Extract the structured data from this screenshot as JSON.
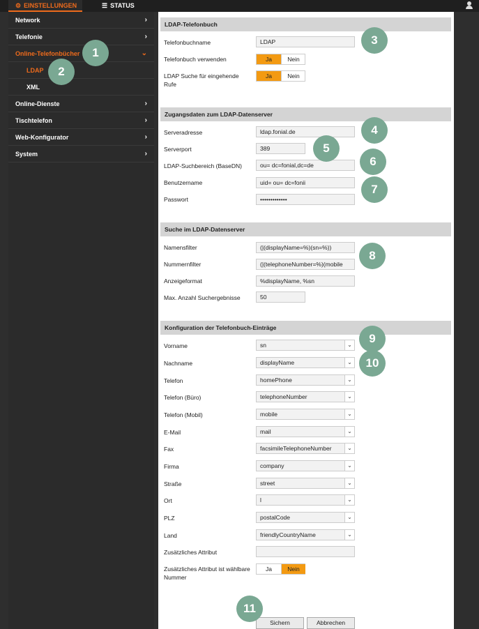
{
  "topbar": {
    "settings_tab": "EINSTELLUNGEN",
    "status_tab": "STATUS"
  },
  "sidebar": {
    "items": [
      {
        "label": "Network"
      },
      {
        "label": "Telefonie"
      },
      {
        "label": "Online-Telefonbücher"
      },
      {
        "label": "LDAP"
      },
      {
        "label": "XML"
      },
      {
        "label": "Online-Dienste"
      },
      {
        "label": "Tischtelefon"
      },
      {
        "label": "Web-Konfigurator"
      },
      {
        "label": "System"
      }
    ]
  },
  "ldap": {
    "header": "LDAP-Telefonbuch",
    "name_label": "Telefonbuchname",
    "name_value": "LDAP",
    "use_label": "Telefonbuch verwenden",
    "search_label": "LDAP Suche für eingehende Rufe",
    "yes": "Ja",
    "no": "Nein"
  },
  "server": {
    "header": "Zugangsdaten zum LDAP-Datenserver",
    "address_label": "Serveradresse",
    "address_value": "ldap.fonial.de",
    "port_label": "Serverport",
    "port_value": "389",
    "basedn_label": "LDAP-Suchbereich (BaseDN)",
    "basedn_value": "ou=         dc=fonial,dc=de",
    "user_label": "Benutzername",
    "user_value": "uid=       ou=       dc=fonii",
    "pass_label": "Passwort",
    "pass_value": "•••••••••••••"
  },
  "search": {
    "header": "Suche im LDAP-Datenserver",
    "namefilter_label": "Namensfilter",
    "namefilter_value": "(|(displayName=%)(sn=%))",
    "numberfilter_label": "Nummernfilter",
    "numberfilter_value": "(|(telephoneNumber=%)(mobile",
    "format_label": "Anzeigeformat",
    "format_value": "%displayName, %sn",
    "max_label": "Max. Anzahl Suchergebnisse",
    "max_value": "50"
  },
  "config": {
    "header": "Konfiguration der Telefonbuch-Einträge",
    "rows": [
      {
        "label": "Vorname",
        "value": "sn"
      },
      {
        "label": "Nachname",
        "value": "displayName"
      },
      {
        "label": "Telefon",
        "value": "homePhone"
      },
      {
        "label": "Telefon (Büro)",
        "value": "telephoneNumber"
      },
      {
        "label": "Telefon (Mobil)",
        "value": "mobile"
      },
      {
        "label": "E-Mail",
        "value": "mail"
      },
      {
        "label": "Fax",
        "value": "facsimileTelephoneNumber"
      },
      {
        "label": "Firma",
        "value": "company"
      },
      {
        "label": "Straße",
        "value": "street"
      },
      {
        "label": "Ort",
        "value": "l"
      },
      {
        "label": "PLZ",
        "value": "postalCode"
      },
      {
        "label": "Land",
        "value": "friendlyCountryName"
      }
    ],
    "extra_label": "Zusätzliches Attribut",
    "extra_value": "",
    "extra_dial_label": "Zusätzliches Attribut ist wählbare Nummer",
    "yes": "Ja",
    "no": "Nein"
  },
  "actions": {
    "save": "Sichern",
    "cancel": "Abbrechen"
  },
  "badges": [
    "1",
    "2",
    "3",
    "4",
    "5",
    "6",
    "7",
    "8",
    "9",
    "10",
    "11"
  ],
  "colors": {
    "accent": "#ef6b1c",
    "toggle_on": "#f39a12",
    "badge": "#7aa893"
  }
}
